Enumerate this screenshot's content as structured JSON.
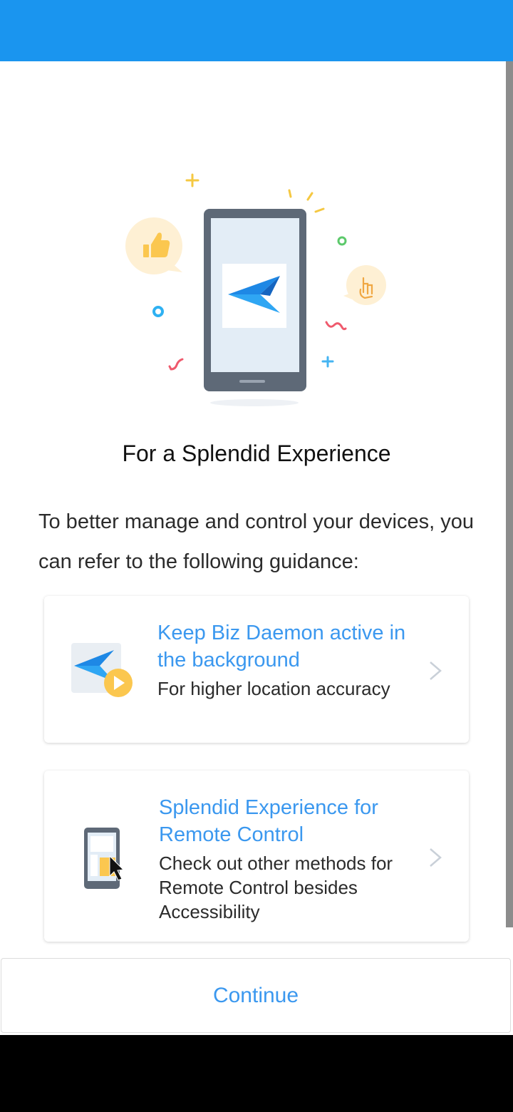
{
  "colors": {
    "topbar": "#1a95ef",
    "accent": "#3b98ef",
    "text": "#2b2b2b",
    "navbar": "#000000"
  },
  "hero": {
    "icon": "phone-with-airdroid-logo-illustration"
  },
  "title": "For a Splendid Experience",
  "description": "To better manage and control your devices, you can refer to the following guidance:",
  "cards": [
    {
      "icon": "biz-daemon-play-icon",
      "heading": "Keep Biz Daemon active in the background",
      "sub": "For higher location accuracy",
      "chevron": "chevron-right-icon"
    },
    {
      "icon": "remote-control-phone-icon",
      "heading": "Splendid Experience for Remote Control",
      "sub": "Check out other methods for Remote Control besides Accessibility",
      "chevron": "chevron-right-icon"
    }
  ],
  "continue_label": "Continue"
}
